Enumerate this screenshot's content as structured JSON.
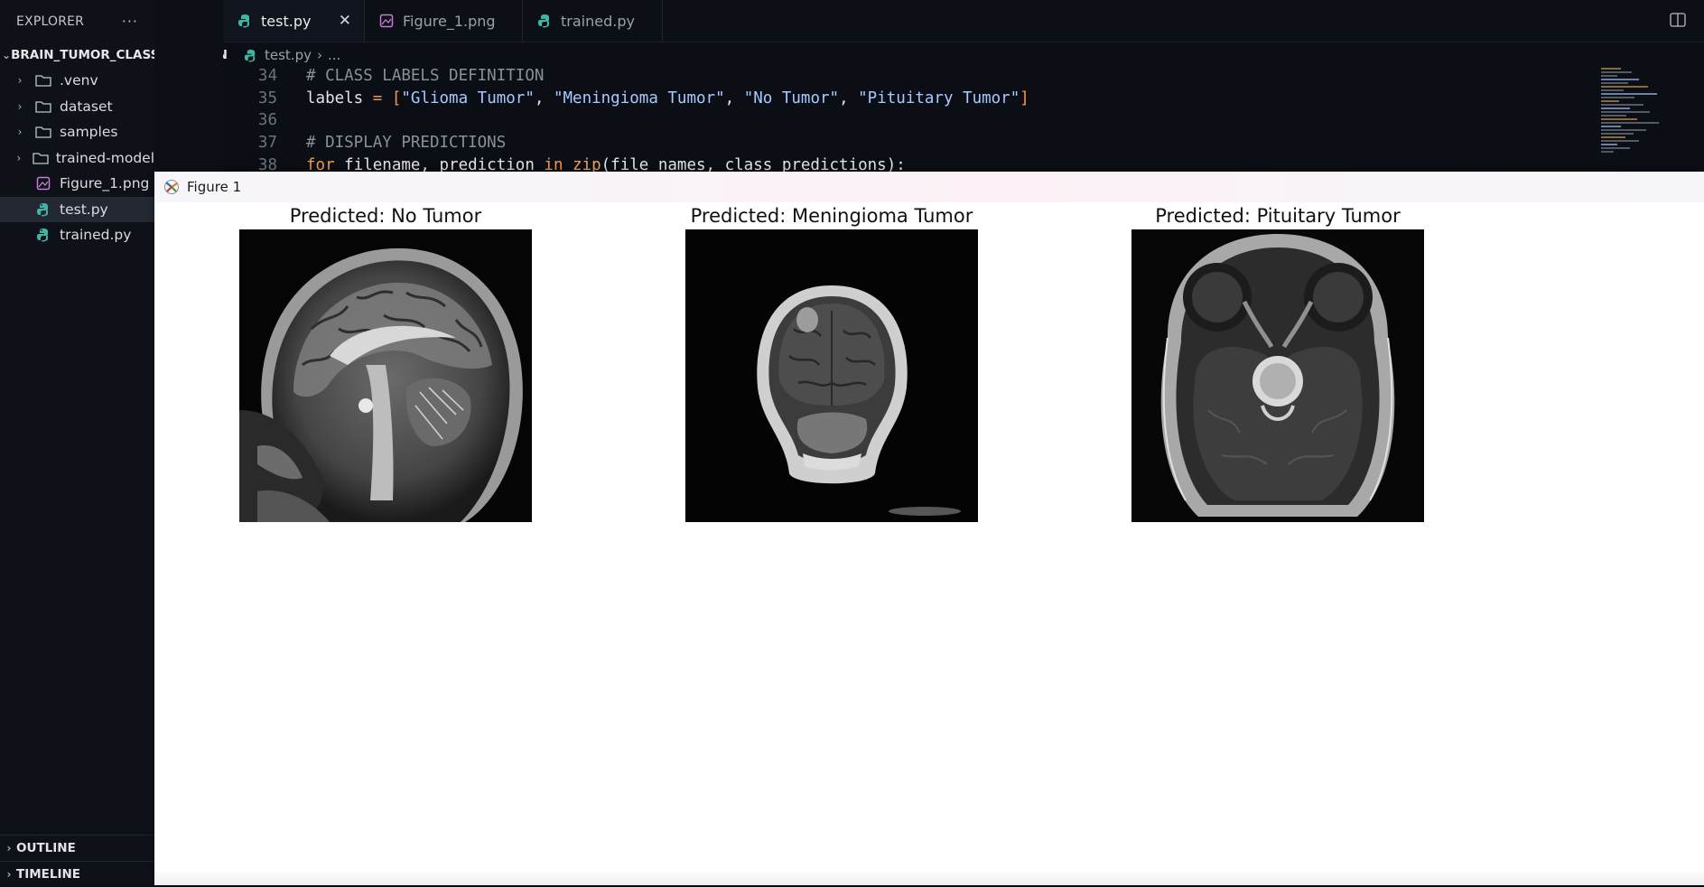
{
  "sidebar": {
    "header": "EXPLORER",
    "more": "···",
    "project": "BRAIN_TUMOR_CLASSIFICATION",
    "folders": [
      ".venv",
      "dataset",
      "samples",
      "trained-model"
    ],
    "files": [
      "Figure_1.png",
      "test.py",
      "trained.py"
    ],
    "active_file": "test.py",
    "outline": "OUTLINE",
    "timeline": "TIMELINE"
  },
  "tabs": [
    {
      "label": "test.py",
      "icon": "python-icon",
      "active": true,
      "close": "✕"
    },
    {
      "label": "Figure_1.png",
      "icon": "image-icon",
      "active": false
    },
    {
      "label": "trained.py",
      "icon": "python-icon",
      "active": false
    }
  ],
  "breadcrumb": {
    "file": "test.py",
    "sep": "›",
    "more": "..."
  },
  "editor": {
    "lines": [
      {
        "num": "34",
        "comment": "# CLASS LABELS DEFINITION"
      },
      {
        "num": "35",
        "var": "labels",
        "op": " = [",
        "strings": [
          "\"Glioma Tumor\"",
          "\"Meningioma Tumor\"",
          "\"No Tumor\"",
          "\"Pituitary Tumor\""
        ],
        "sep": ", ",
        "close": "]"
      },
      {
        "num": "36"
      },
      {
        "num": "37",
        "comment": "# DISPLAY PREDICTIONS"
      },
      {
        "num": "38",
        "kw1": "for",
        "mid1": " filename, prediction ",
        "kw2": "in",
        "fn": " zip",
        "rest": "(file_names, class_predictions):"
      }
    ]
  },
  "figure": {
    "window_title": "Figure 1",
    "panels": [
      {
        "title": "Predicted: No Tumor"
      },
      {
        "title": "Predicted: Meningioma Tumor"
      },
      {
        "title": "Predicted: Pituitary Tumor"
      }
    ]
  },
  "colors": {
    "accent_python": "#3fb5a3",
    "image_icon": "#c27bd6",
    "keyword": "#f09a50"
  }
}
